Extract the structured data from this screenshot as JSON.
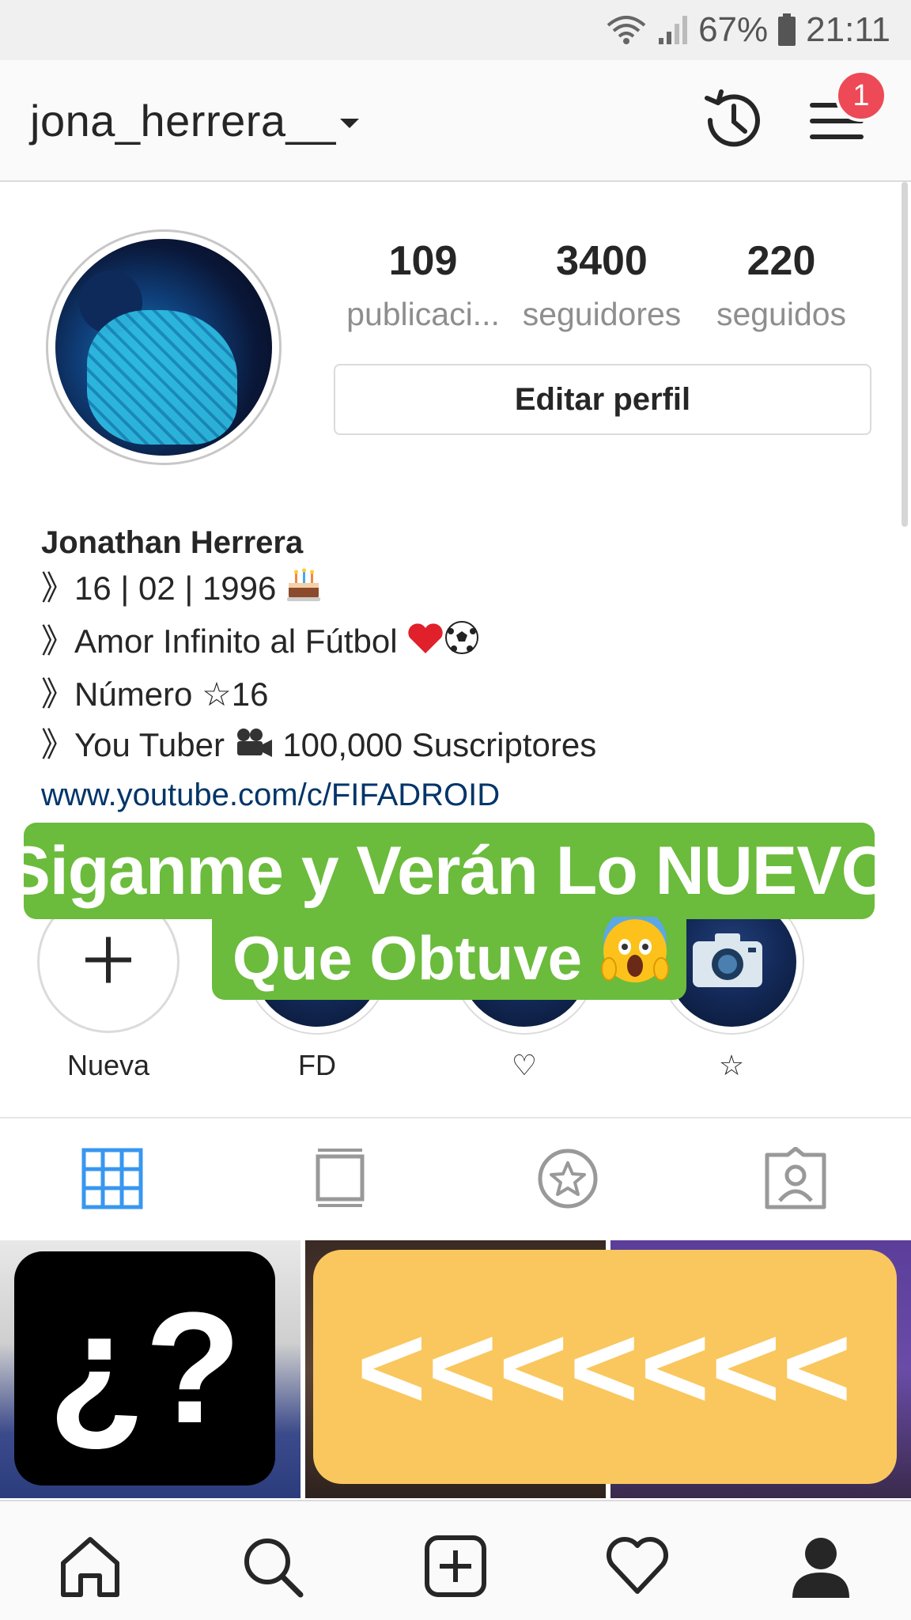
{
  "status_bar": {
    "battery": "67%",
    "time": "21:11"
  },
  "header": {
    "username": "jona_herrera__",
    "notification_count": "1"
  },
  "profile": {
    "stats": [
      {
        "value": "109",
        "label": "publicaci..."
      },
      {
        "value": "3400",
        "label": "seguidores"
      },
      {
        "value": "220",
        "label": "seguidos"
      }
    ],
    "edit_button": "Editar perfil"
  },
  "bio": {
    "name": "Jonathan Herrera",
    "arrow": "》",
    "lines": [
      "16 | 02 | 1996",
      "Amor Infinito al Fútbol",
      "Número ☆16",
      "You Tuber",
      "100,000 Suscriptores"
    ],
    "link": "www.youtube.com/c/FIFADROID"
  },
  "highlights": [
    {
      "label": "Nueva"
    },
    {
      "label": "FD"
    },
    {
      "label": "♡"
    },
    {
      "label": "☆"
    }
  ],
  "overlay": {
    "line1": "Siganme y Verán Lo NUEVO",
    "line2": "Que Obtuve"
  },
  "posts": {
    "question_text": "¿?",
    "arrows_text": "<<<<<<<"
  },
  "colors": {
    "accent_blue": "#3897f0",
    "link_blue": "#003569",
    "badge_red": "#ed4956",
    "banner_green": "#6bbb3c",
    "arrow_yellow": "#f9c75e"
  },
  "icons": {
    "header": [
      "history-icon",
      "menu-icon"
    ],
    "tabs": [
      "grid-icon",
      "feed-icon",
      "saved-icon",
      "tagged-icon"
    ],
    "nav": [
      "home-icon",
      "search-icon",
      "add-icon",
      "heart-icon",
      "profile-icon"
    ]
  }
}
